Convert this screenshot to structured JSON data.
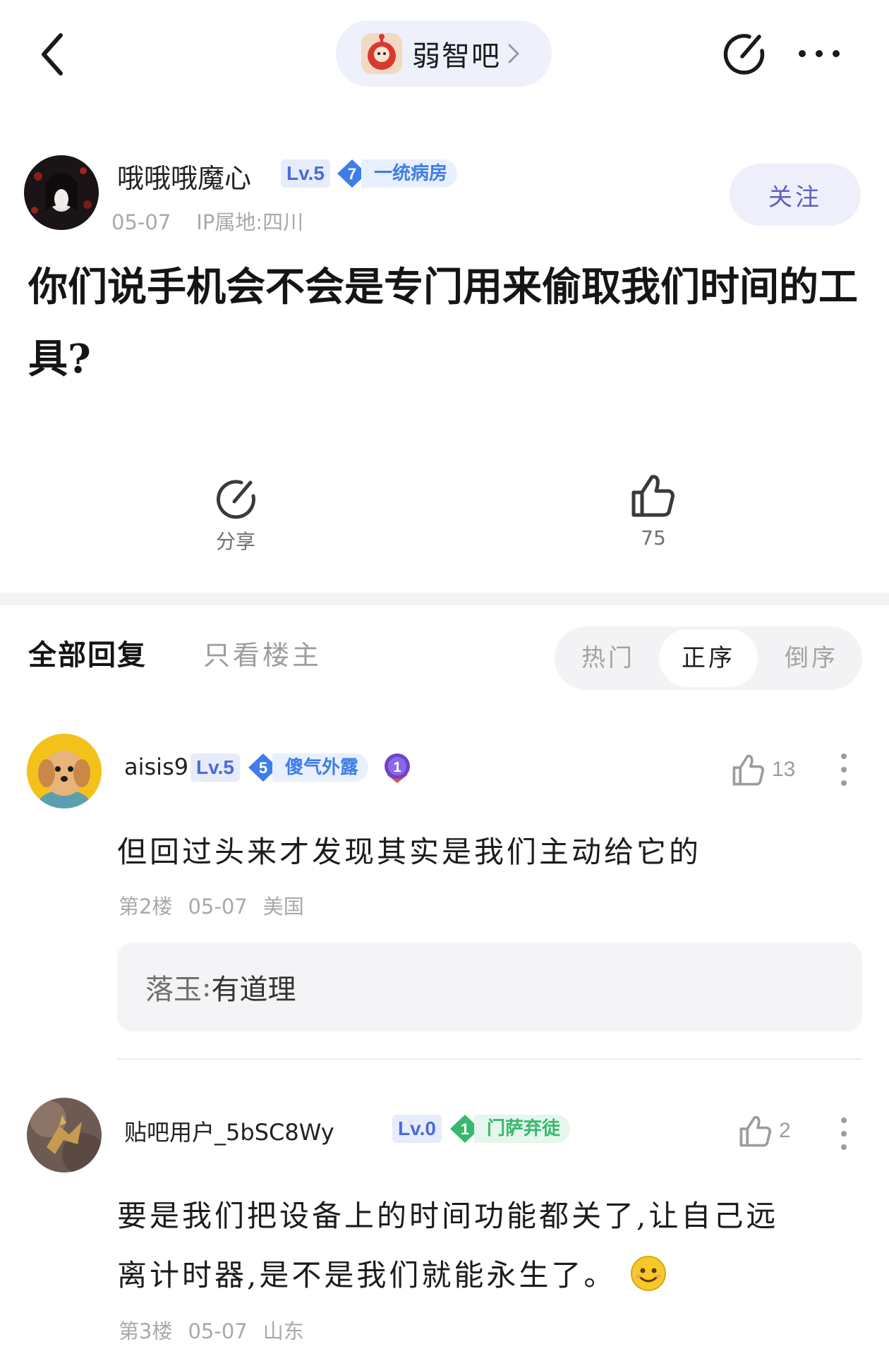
{
  "header": {
    "forum_name": "弱智吧"
  },
  "post": {
    "author": {
      "name": "哦哦哦魔心",
      "level": "Lv.5",
      "title_level": "7",
      "title_text": "一统病房"
    },
    "date": "05-07",
    "ip_location": "IP属地:四川",
    "follow_label": "关注",
    "title": "你们说手机会不会是专门用来偷取我们时间的工具?",
    "share_label": "分享",
    "like_count": "75"
  },
  "replies_header": {
    "tab_all": "全部回复",
    "tab_op_only": "只看楼主",
    "sort_options": [
      "热门",
      "正序",
      "倒序"
    ],
    "active_sort": "正序"
  },
  "replies": [
    {
      "user": "aisis9",
      "level": "Lv.5",
      "title_level": "5",
      "title_text": "傻气外露",
      "medal": "1",
      "like_count": "13",
      "text": "但回过头来才发现其实是我们主动给它的",
      "floor": "第2楼",
      "date": "05-07",
      "location": "美国",
      "sub_reply": {
        "author": "落玉",
        "separator": ":",
        "text": "有道理"
      }
    },
    {
      "user": "贴吧用户_5bSC8Wy",
      "level": "Lv.0",
      "title_level": "1",
      "title_text": "门萨弃徒",
      "like_count": "2",
      "text_line1": "要是我们把设备上的时间功能都关了,让自己远",
      "text_line2": "离计时器,是不是我们就能永生了。",
      "floor": "第3楼",
      "date": "05-07",
      "location": "山东"
    }
  ],
  "colors": {
    "accent": "#5d5fc0",
    "level_badge_bg": "#e7ecfb",
    "level_badge_text": "#4c6bd8",
    "title_blue": "#3f7de8",
    "title_green": "#39b86e",
    "meta_gray": "#a9a9a9"
  }
}
